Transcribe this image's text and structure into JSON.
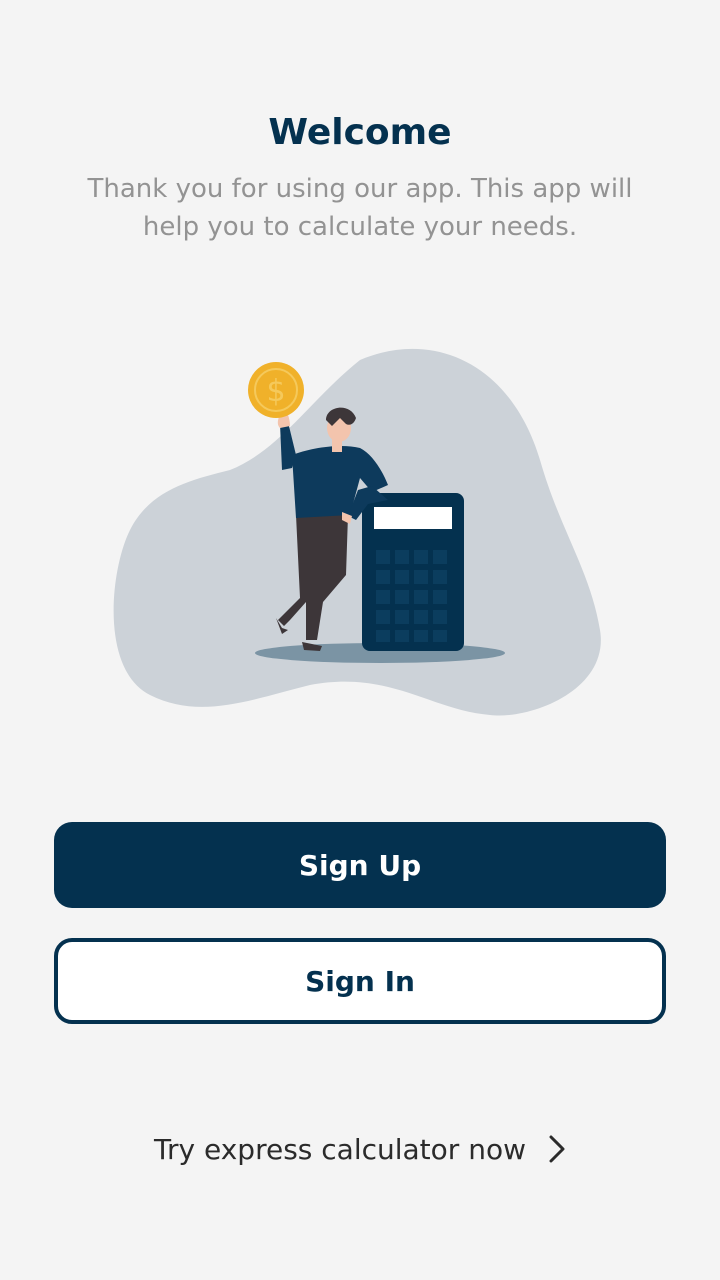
{
  "welcome": {
    "title": "Welcome",
    "subtitle": "Thank you for using our app. This app will help you to calculate your needs."
  },
  "illustration": {
    "description_icon": "person-with-coin-and-calculator-illustration"
  },
  "actions": {
    "sign_up_label": "Sign Up",
    "sign_in_label": "Sign In",
    "express_label": "Try express calculator now",
    "express_icon": "chevron-right-icon"
  },
  "colors": {
    "primary": "#04314f",
    "background": "#f4f4f4",
    "subtitle": "#939393",
    "coin": "#f0b12a",
    "blob": "#ccd2d8"
  }
}
